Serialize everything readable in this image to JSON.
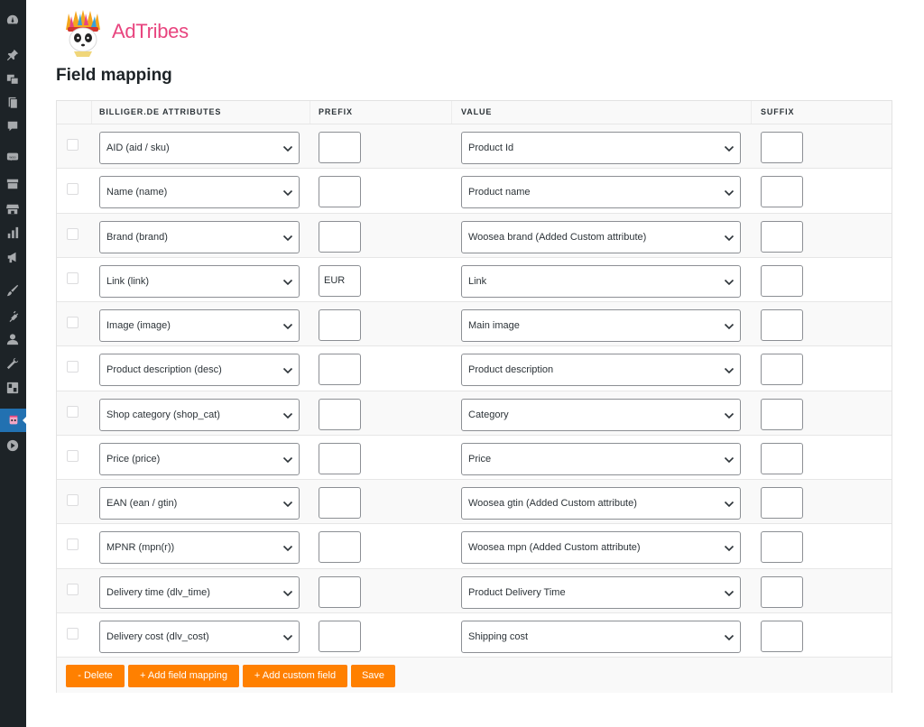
{
  "sidebar": {
    "icons": [
      "dashboard-icon",
      "pin-icon",
      "media-icon",
      "pages-icon",
      "comments-icon",
      "woocommerce-icon",
      "products-icon",
      "store-icon",
      "analytics-icon",
      "marketing-icon",
      "appearance-icon",
      "plugins-icon",
      "users-icon",
      "tools-icon",
      "settings-icon",
      "adtribes-menu-icon",
      "play-icon"
    ],
    "current": "adtribes-menu-icon"
  },
  "brand": {
    "name": "AdTribes",
    "color": "#e8457f",
    "logo_icon": "panda-logo-icon"
  },
  "page_title": "Field mapping",
  "table": {
    "headers": {
      "attributes": "BILLIGER.DE ATTRIBUTES",
      "prefix": "PREFIX",
      "value": "VALUE",
      "suffix": "SUFFIX"
    },
    "rows": [
      {
        "attribute": "AID (aid / sku)",
        "prefix": "",
        "value": "Product Id",
        "suffix": ""
      },
      {
        "attribute": "Name (name)",
        "prefix": "",
        "value": "Product name",
        "suffix": ""
      },
      {
        "attribute": "Brand (brand)",
        "prefix": "",
        "value": "Woosea brand (Added Custom attribute)",
        "suffix": ""
      },
      {
        "attribute": "Link (link)",
        "prefix": "EUR",
        "value": "Link",
        "suffix": ""
      },
      {
        "attribute": "Image (image)",
        "prefix": "",
        "value": "Main image",
        "suffix": ""
      },
      {
        "attribute": "Product description (desc)",
        "prefix": "",
        "value": "Product description",
        "suffix": ""
      },
      {
        "attribute": "Shop category (shop_cat)",
        "prefix": "",
        "value": "Category",
        "suffix": ""
      },
      {
        "attribute": "Price (price)",
        "prefix": "",
        "value": "Price",
        "suffix": ""
      },
      {
        "attribute": "EAN (ean / gtin)",
        "prefix": "",
        "value": "Woosea gtin (Added Custom attribute)",
        "suffix": ""
      },
      {
        "attribute": "MPNR (mpn(r))",
        "prefix": "",
        "value": "Woosea mpn (Added Custom attribute)",
        "suffix": ""
      },
      {
        "attribute": "Delivery time (dlv_time)",
        "prefix": "",
        "value": "Product Delivery Time",
        "suffix": ""
      },
      {
        "attribute": "Delivery cost (dlv_cost)",
        "prefix": "",
        "value": "Shipping cost",
        "suffix": ""
      }
    ]
  },
  "actions": {
    "delete": "- Delete",
    "add_field_mapping": "+ Add field mapping",
    "add_custom_field": "+ Add custom field",
    "save": "Save"
  },
  "colors": {
    "button": "#ff8000",
    "sidebar": "#1d2327",
    "sidebar_current": "#2271b1"
  }
}
